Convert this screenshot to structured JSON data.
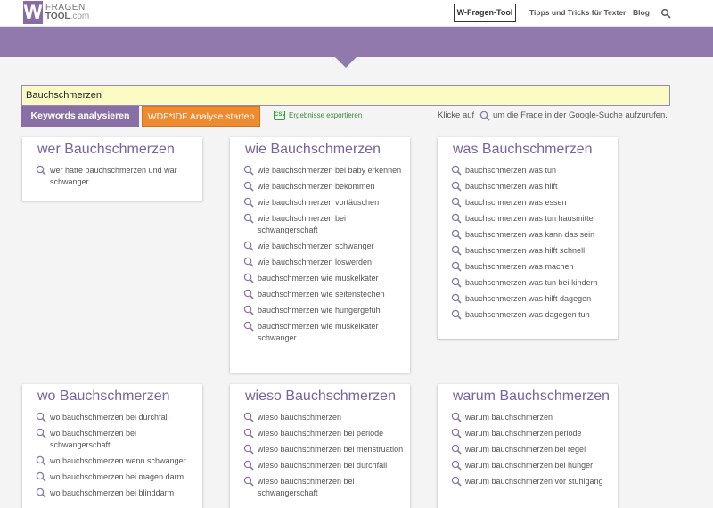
{
  "nav": {
    "logo_letter": "W",
    "logo_line1": "FRAGEN",
    "logo_line2": "TOOL",
    "logo_suffix": ".com",
    "active": "W-Fragen-Tool",
    "links": [
      "Tipps und Tricks für Texter",
      "Blog"
    ]
  },
  "search": {
    "value": "Bauchschmerzen",
    "analyze_label": "Keywords analysieren",
    "wdf_label": "WDF*IDF Analyse starten",
    "csv_icon_text": "CSV",
    "export_label": "Ergebnisse exportieren",
    "hint_before": "Klicke auf",
    "hint_after": "um die Frage in der Google-Suche aufzurufen."
  },
  "cards": [
    {
      "title": "wer Bauchschmerzen",
      "items": [
        "wer hatte bauchschmerzen und war schwanger"
      ]
    },
    {
      "title": "wie Bauchschmerzen",
      "items": [
        "wie bauchschmerzen bei baby erkennen",
        "wie bauchschmerzen bekommen",
        "wie bauchschmerzen vortäuschen",
        "wie bauchschmerzen bei schwangerschaft",
        "wie bauchschmerzen schwanger",
        "wie bauchschmerzen loswerden",
        "bauchschmerzen wie muskelkater",
        "bauchschmerzen wie seitenstechen",
        "bauchschmerzen wie hungergefühl",
        "bauchschmerzen wie muskelkater schwanger"
      ]
    },
    {
      "title": "was Bauchschmerzen",
      "items": [
        "bauchschmerzen was tun",
        "bauchschmerzen was hilft",
        "bauchschmerzen was essen",
        "bauchschmerzen was tun hausmittel",
        "bauchschmerzen was kann das sein",
        "bauchschmerzen was hilft schnell",
        "bauchschmerzen was machen",
        "bauchschmerzen was tun bei kindern",
        "bauchschmerzen was hilft dagegen",
        "bauchschmerzen was dagegen tun"
      ]
    },
    {
      "title": "wo Bauchschmerzen",
      "items": [
        "wo bauchschmerzen bei durchfall",
        "wo bauchschmerzen bei schwangerschaft",
        "wo bauchschmerzen wenn schwanger",
        "wo bauchschmerzen bei magen darm",
        "wo bauchschmerzen bei blinddarm"
      ]
    },
    {
      "title": "wieso Bauchschmerzen",
      "items": [
        "wieso bauchschmerzen",
        "wieso bauchschmerzen bei periode",
        "wieso bauchschmerzen bei menstruation",
        "wieso bauchschmerzen bei durchfall",
        "wieso bauchschmerzen bei schwangerschaft"
      ]
    },
    {
      "title": "warum Bauchschmerzen",
      "items": [
        "warum bauchschmerzen",
        "warum bauchschmerzen periode",
        "warum bauchschmerzen bei regel",
        "warum bauchschmerzen bei hunger",
        "warum bauchschmerzen vor stuhlgang"
      ]
    }
  ],
  "colors": {
    "purple": "#9179ad",
    "title_purple": "#7a63a0",
    "orange": "#ee8a30",
    "input_bg": "#fbfbc4"
  }
}
